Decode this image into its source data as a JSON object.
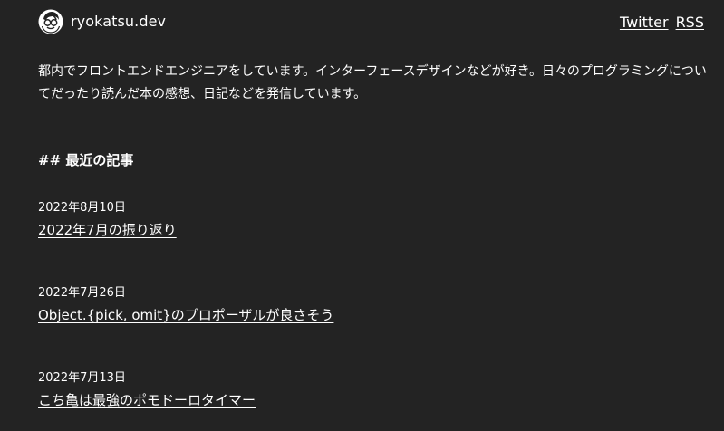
{
  "site": {
    "name": "ryokatsu.dev"
  },
  "nav": {
    "twitter": "Twitter",
    "rss": "RSS"
  },
  "intro": "都内でフロントエンドエンジニアをしています。インターフェースデザインなどが好き。日々のプログラミングについてだったり読んだ本の感想、日記などを発信しています。",
  "section": {
    "title": "## 最近の記事"
  },
  "posts": [
    {
      "date": "2022年8月10日",
      "title": "2022年7月の振り返り"
    },
    {
      "date": "2022年7月26日",
      "title": "Object.{pick, omit}のプロポーザルが良さそう"
    },
    {
      "date": "2022年7月13日",
      "title": "こち亀は最強のポモドーロタイマー"
    }
  ],
  "colors": {
    "background": "#232323",
    "text": "#ffffff"
  },
  "icons": {
    "logo": "avatar-face-icon"
  }
}
